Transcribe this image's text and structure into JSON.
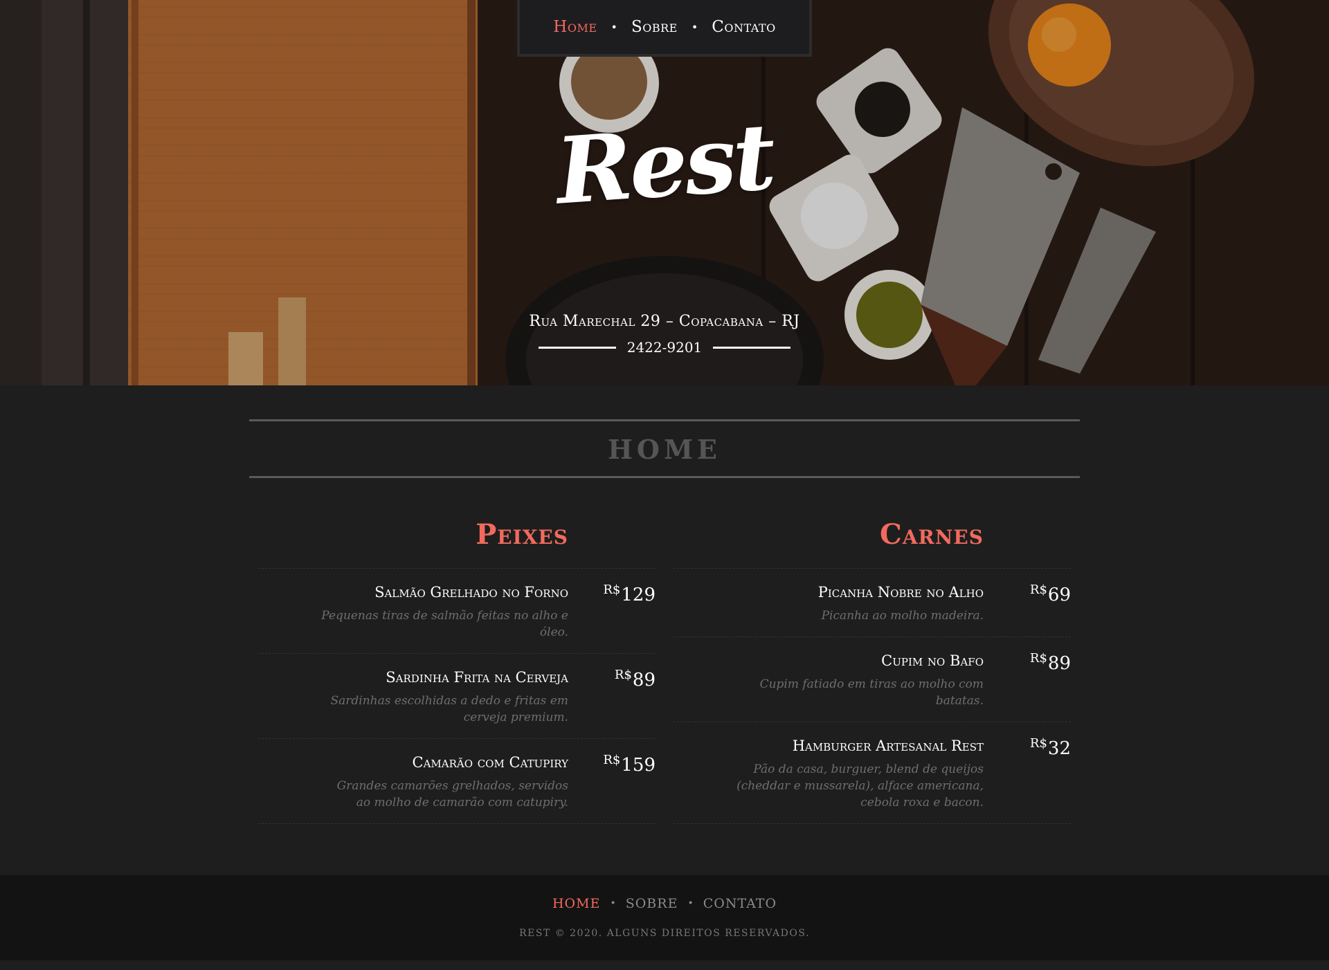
{
  "nav": {
    "items": [
      {
        "label": "Home",
        "active": true
      },
      {
        "label": "Sobre",
        "active": false
      },
      {
        "label": "Contato",
        "active": false
      }
    ]
  },
  "hero": {
    "logo": "Rest",
    "address": "Rua Marechal 29 – Copacabana – RJ",
    "phone": "2422-9201"
  },
  "section": {
    "title": "HOME"
  },
  "menu": {
    "fish": {
      "title": "Peixes",
      "items": [
        {
          "name": "Salmão Grelhado no Forno",
          "desc": "Pequenas tiras de salmão feitas no alho e óleo.",
          "currency": "R$",
          "price": "129"
        },
        {
          "name": "Sardinha Frita na Cerveja",
          "desc": "Sardinhas escolhidas a dedo e fritas em cerveja premium.",
          "currency": "R$",
          "price": "89"
        },
        {
          "name": "Camarão com Catupiry",
          "desc": "Grandes camarões grelhados, servidos ao molho de camarão com catupiry.",
          "currency": "R$",
          "price": "159"
        }
      ]
    },
    "meat": {
      "title": "Carnes",
      "items": [
        {
          "name": "Picanha Nobre no Alho",
          "desc": "Picanha ao molho madeira.",
          "currency": "R$",
          "price": "69"
        },
        {
          "name": "Cupim no Bafo",
          "desc": "Cupim fatiado em tiras ao molho com batatas.",
          "currency": "R$",
          "price": "89"
        },
        {
          "name": "Hamburger Artesanal Rest",
          "desc": "Pão da casa, burguer, blend de queijos (cheddar e mussarela), alface americana, cebola roxa e bacon.",
          "currency": "R$",
          "price": "32"
        }
      ]
    }
  },
  "footer": {
    "nav": [
      {
        "label": "HOME",
        "active": true
      },
      {
        "label": "SOBRE",
        "active": false
      },
      {
        "label": "CONTATO",
        "active": false
      }
    ],
    "copyright": "REST © 2020. ALGUNS DIREITOS RESERVADOS."
  },
  "colors": {
    "accent": "#f26a5e",
    "background": "#1e1e1e",
    "footer_bg": "#131313"
  }
}
